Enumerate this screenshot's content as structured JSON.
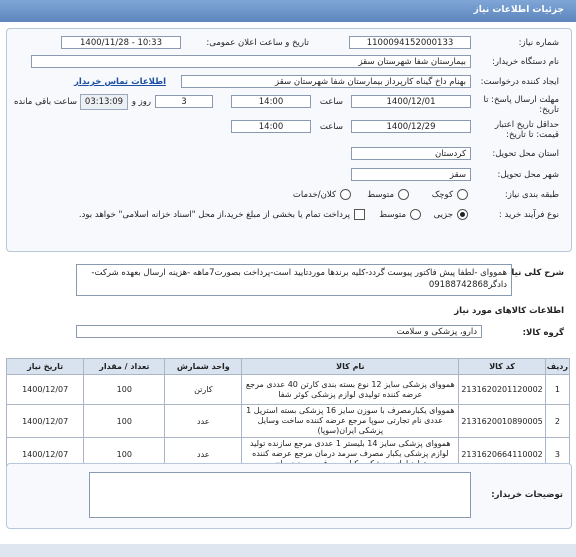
{
  "header": {
    "title": "جزئیات اطلاعات نیاز"
  },
  "fields": {
    "need_number_label": "شماره نیاز:",
    "need_number": "1100094152000133",
    "announce_label": "تاریخ و ساعت اعلان عمومی:",
    "announce_value": "1400/11/28 - 10:33",
    "buyer_org_label": "نام دستگاه خریدار:",
    "buyer_org": "بیمارستان شفا شهرستان سقز",
    "creator_label": "ایجاد کننده درخواست:",
    "creator": "بهنام داخ گیناه کارپرداز بیمارستان شفا شهرستان سقز",
    "contact_link": "اطلاعات تماس خریدار",
    "deadline_label": "مهلت ارسال پاسخ: تا تاریخ:",
    "deadline_date": "1400/12/01",
    "time_label": "ساعت",
    "deadline_time": "14:00",
    "days_value": "3",
    "days_label": "روز و",
    "remaining_time": "03:13:09",
    "remaining_label": "ساعت باقی مانده",
    "validity_label": "حداقل تاریخ اعتبار قیمت: تا تاریخ:",
    "validity_date": "1400/12/29",
    "validity_time": "14:00",
    "province_label": "استان محل تحویل:",
    "province": "کردستان",
    "city_label": "شهر محل تحویل:",
    "city": "سقز",
    "category_label": "طبقه بندی نیاز:",
    "cat_small": "کوچک",
    "cat_medium": "متوسط",
    "cat_large": "کلان/خدمات",
    "purchase_label": "نوع فرآیند خرید :",
    "purchase_partial": "جزیی",
    "purchase_medium": "متوسط",
    "payment_note": "پرداخت تمام یا بخشی از مبلغ خرید،از محل \"اسناد خزانه اسلامی\" خواهد بود."
  },
  "description": {
    "label": "شرح کلی نیاز:",
    "text": "همووای -لطفا پیش فاکتور پیوست گردد-کلیه برندها موردتایید است-پرداخت بصورت7ماهه -هزینه ارسال بعهده شرکت-دادگر09188742868"
  },
  "goods_title": "اطلاعات کالاهای مورد نیاز",
  "group": {
    "label": "گروه کالا:",
    "value": "دارو، پزشکی و سلامت"
  },
  "table": {
    "headers": [
      "ردیف",
      "کد کالا",
      "نام کالا",
      "واحد شمارش",
      "تعداد / مقدار",
      "تاریخ نیاز"
    ],
    "rows": [
      {
        "row": "1",
        "code": "2131620201120002",
        "name": "همووای پزشکی سایز 12 نوع بسته بندی کارتن 40 عددی مرجع عرضه کننده تولیدی لوازم پزشکی کوثر شفا",
        "unit": "کارتن",
        "qty": "100",
        "date": "1400/12/07"
      },
      {
        "row": "2",
        "code": "2131620010890005",
        "name": "همووای یکبارمصرف با سوزن سایز 16 پزشکی بسته استریل 1 عددی نام تجارتی سوپا مرجع عرضه کننده ساخت وسایل پزشکی ایران(سوپا)",
        "unit": "عدد",
        "qty": "100",
        "date": "1400/12/07"
      },
      {
        "row": "3",
        "code": "2131620664110002",
        "name": "همووای پزشکی سایز 14 بلیستر 1 عددی مرجع سازنده تولید لوازم پزشکی یکبار مصرف سرمد درمان مرجع عرضه کننده تولید لوازم پزشکی یکبار مصرف سرمد درمان",
        "unit": "عدد",
        "qty": "100",
        "date": "1400/12/07"
      }
    ]
  },
  "notes": {
    "label": "توضیحات خریدار:",
    "text": ""
  },
  "colors": {
    "header": "#5d86bd",
    "link": "#1a4fa3"
  }
}
